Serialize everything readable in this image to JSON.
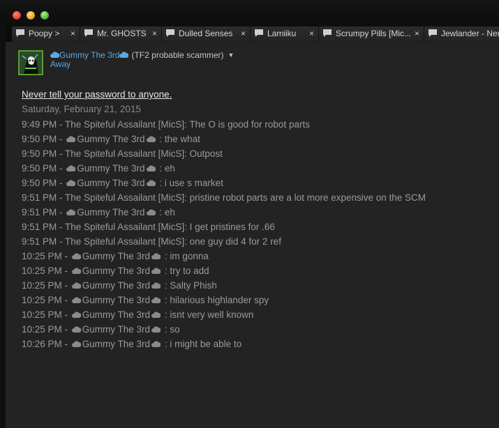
{
  "tabs": [
    {
      "label": "Poopy &gt;",
      "close": "×"
    },
    {
      "label": "Mr. GHOSTS",
      "close": "×"
    },
    {
      "label": "Dulled Senses",
      "close": "×"
    },
    {
      "label": "Lamiiku",
      "close": "×"
    },
    {
      "label": "Scrumpy Pills [Mic...",
      "close": "×"
    },
    {
      "label": "Jewlander - Ner",
      "close": ""
    }
  ],
  "friend": {
    "name": "Gummy The 3rd",
    "nickname": "(TF2 probable scammer)",
    "status": "Away",
    "name_color": "#5aa8e0"
  },
  "chat": {
    "warning": "Never tell your password to anyone.",
    "date": "Saturday, February 21, 2015",
    "messages": [
      {
        "time": "9:49 PM",
        "sender": "The Spiteful Assailant [MicS]",
        "cloud": false,
        "text": "The O is good for robot parts"
      },
      {
        "time": "9:50 PM",
        "sender": "Gummy The 3rd",
        "cloud": true,
        "text": "the what"
      },
      {
        "time": "9:50 PM",
        "sender": "The Spiteful Assailant [MicS]",
        "cloud": false,
        "text": "Outpost"
      },
      {
        "time": "9:50 PM",
        "sender": "Gummy The 3rd",
        "cloud": true,
        "text": "eh"
      },
      {
        "time": "9:50 PM",
        "sender": "Gummy The 3rd",
        "cloud": true,
        "text": "i use s market"
      },
      {
        "time": "9:51 PM",
        "sender": "The Spiteful Assailant [MicS]",
        "cloud": false,
        "text": "pristine robot parts are a lot more expensive on the SCM"
      },
      {
        "time": "9:51 PM",
        "sender": "Gummy The 3rd",
        "cloud": true,
        "text": "eh"
      },
      {
        "time": "9:51 PM",
        "sender": "The Spiteful Assailant [MicS]",
        "cloud": false,
        "text": "I get pristines for .66"
      },
      {
        "time": "9:51 PM",
        "sender": "The Spiteful Assailant [MicS]",
        "cloud": false,
        "text": "one guy did 4 for 2 ref"
      },
      {
        "time": "10:25 PM",
        "sender": "Gummy The 3rd",
        "cloud": true,
        "text": "im gonna"
      },
      {
        "time": "10:25 PM",
        "sender": "Gummy The 3rd",
        "cloud": true,
        "text": "try to add"
      },
      {
        "time": "10:25 PM",
        "sender": "Gummy The 3rd",
        "cloud": true,
        "text": "Salty Phish"
      },
      {
        "time": "10:25 PM",
        "sender": "Gummy The 3rd",
        "cloud": true,
        "text": "hilarious highlander spy"
      },
      {
        "time": "10:25 PM",
        "sender": "Gummy The 3rd",
        "cloud": true,
        "text": "isnt very well known"
      },
      {
        "time": "10:25 PM",
        "sender": "Gummy The 3rd",
        "cloud": true,
        "text": "so"
      },
      {
        "time": "10:26 PM",
        "sender": "Gummy The 3rd",
        "cloud": true,
        "text": "i might be able to"
      }
    ]
  }
}
